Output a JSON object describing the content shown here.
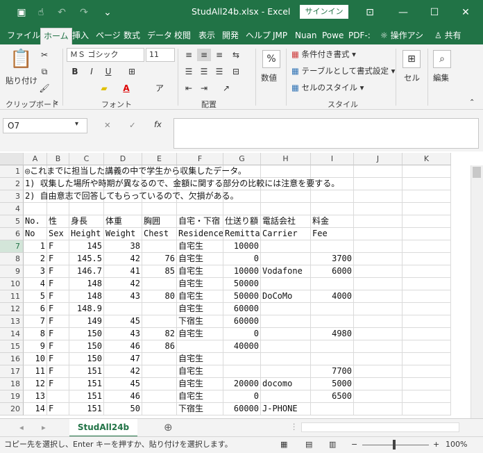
{
  "window": {
    "title": "StudAll24b.xlsx - Excel",
    "signin": "サインイン"
  },
  "tabs": [
    "ファイル",
    "ホーム",
    "挿入",
    "ページ",
    "数式",
    "データ",
    "校閲",
    "表示",
    "開発",
    "ヘルプ",
    "JMP",
    "Nuan",
    "Powe",
    "PDF-:",
    "操作アシ",
    "共有"
  ],
  "ribbon": {
    "paste": "貼り付け",
    "clipboard": "クリップボード",
    "font_name": "ＭＳ ゴシック",
    "font_size": "11",
    "font_group": "フォント",
    "bold": "B",
    "italic": "I",
    "underline": "U",
    "font_color_a": "A",
    "align_group": "配置",
    "number": "数値",
    "percent": "%",
    "cond_format": "条件付き書式",
    "table_format": "テーブルとして書式設定",
    "cell_style": "セルのスタイル",
    "style_group": "スタイル",
    "cell": "セル",
    "edit": "編集"
  },
  "formula": {
    "namebox": "O7",
    "fx": "fx",
    "cancel": "✕",
    "enter": "✓"
  },
  "columns": [
    "A",
    "B",
    "C",
    "D",
    "E",
    "F",
    "G",
    "H",
    "I",
    "J",
    "K"
  ],
  "rows": [
    {
      "n": "1",
      "c": [
        "◎これまでに担当した講義の中で学生から収集したデータ。",
        "",
        "",
        "",
        "",
        "",
        "",
        "",
        "",
        "",
        ""
      ]
    },
    {
      "n": "2",
      "c": [
        "1) 収集した場所や時期が異なるので、金額に関する部分の比較には注意を要する。",
        "",
        "",
        "",
        "",
        "",
        "",
        "",
        "",
        "",
        ""
      ]
    },
    {
      "n": "3",
      "c": [
        "2) 自由意志で回答してもらっているので、欠損がある。",
        "",
        "",
        "",
        "",
        "",
        "",
        "",
        "",
        "",
        ""
      ]
    },
    {
      "n": "4",
      "c": [
        "",
        "",
        "",
        "",
        "",
        "",
        "",
        "",
        "",
        "",
        ""
      ]
    },
    {
      "n": "5",
      "c": [
        "No.",
        "性",
        "身長",
        "体重",
        "胸囲",
        "自宅・下宿",
        "仕送り額",
        "電話会社",
        "料金",
        "",
        ""
      ]
    },
    {
      "n": "6",
      "c": [
        "No",
        "Sex",
        "Height",
        "Weight",
        "Chest",
        "Residence",
        "Remittance",
        "Carrier",
        "Fee",
        "",
        ""
      ]
    },
    {
      "n": "7",
      "c": [
        "1",
        "F",
        "145",
        "38",
        "",
        "自宅生",
        "10000",
        "",
        "",
        "",
        ""
      ]
    },
    {
      "n": "8",
      "c": [
        "2",
        "F",
        "145.5",
        "42",
        "76",
        "自宅生",
        "0",
        "",
        "3700",
        "",
        ""
      ]
    },
    {
      "n": "9",
      "c": [
        "3",
        "F",
        "146.7",
        "41",
        "85",
        "自宅生",
        "10000",
        "Vodafone",
        "6000",
        "",
        ""
      ]
    },
    {
      "n": "10",
      "c": [
        "4",
        "F",
        "148",
        "42",
        "",
        "自宅生",
        "50000",
        "",
        "",
        "",
        ""
      ]
    },
    {
      "n": "11",
      "c": [
        "5",
        "F",
        "148",
        "43",
        "80",
        "自宅生",
        "50000",
        "DoCoMo",
        "4000",
        "",
        ""
      ]
    },
    {
      "n": "12",
      "c": [
        "6",
        "F",
        "148.9",
        "",
        "",
        "自宅生",
        "60000",
        "",
        "",
        "",
        ""
      ]
    },
    {
      "n": "13",
      "c": [
        "7",
        "F",
        "149",
        "45",
        "",
        "下宿生",
        "60000",
        "",
        "",
        "",
        ""
      ]
    },
    {
      "n": "14",
      "c": [
        "8",
        "F",
        "150",
        "43",
        "82",
        "自宅生",
        "0",
        "",
        "4980",
        "",
        ""
      ]
    },
    {
      "n": "15",
      "c": [
        "9",
        "F",
        "150",
        "46",
        "86",
        "",
        "40000",
        "",
        "",
        "",
        ""
      ]
    },
    {
      "n": "16",
      "c": [
        "10",
        "F",
        "150",
        "47",
        "",
        "自宅生",
        "",
        "",
        "",
        "",
        ""
      ]
    },
    {
      "n": "17",
      "c": [
        "11",
        "F",
        "151",
        "42",
        "",
        "自宅生",
        "",
        "",
        "7700",
        "",
        ""
      ]
    },
    {
      "n": "18",
      "c": [
        "12",
        "F",
        "151",
        "45",
        "",
        "自宅生",
        "20000",
        "docomo",
        "5000",
        "",
        ""
      ]
    },
    {
      "n": "19",
      "c": [
        "13",
        "",
        "151",
        "46",
        "",
        "自宅生",
        "0",
        "",
        "6500",
        "",
        ""
      ]
    },
    {
      "n": "20",
      "c": [
        "14",
        "F",
        "151",
        "50",
        "",
        "下宿生",
        "60000",
        "J-PHONE",
        "",
        "",
        ""
      ]
    }
  ],
  "sheet": {
    "name": "StudAll24b"
  },
  "status": {
    "message": "コピー先を選択し、Enter キーを押すか、貼り付けを選択します。",
    "zoom": "100%"
  }
}
